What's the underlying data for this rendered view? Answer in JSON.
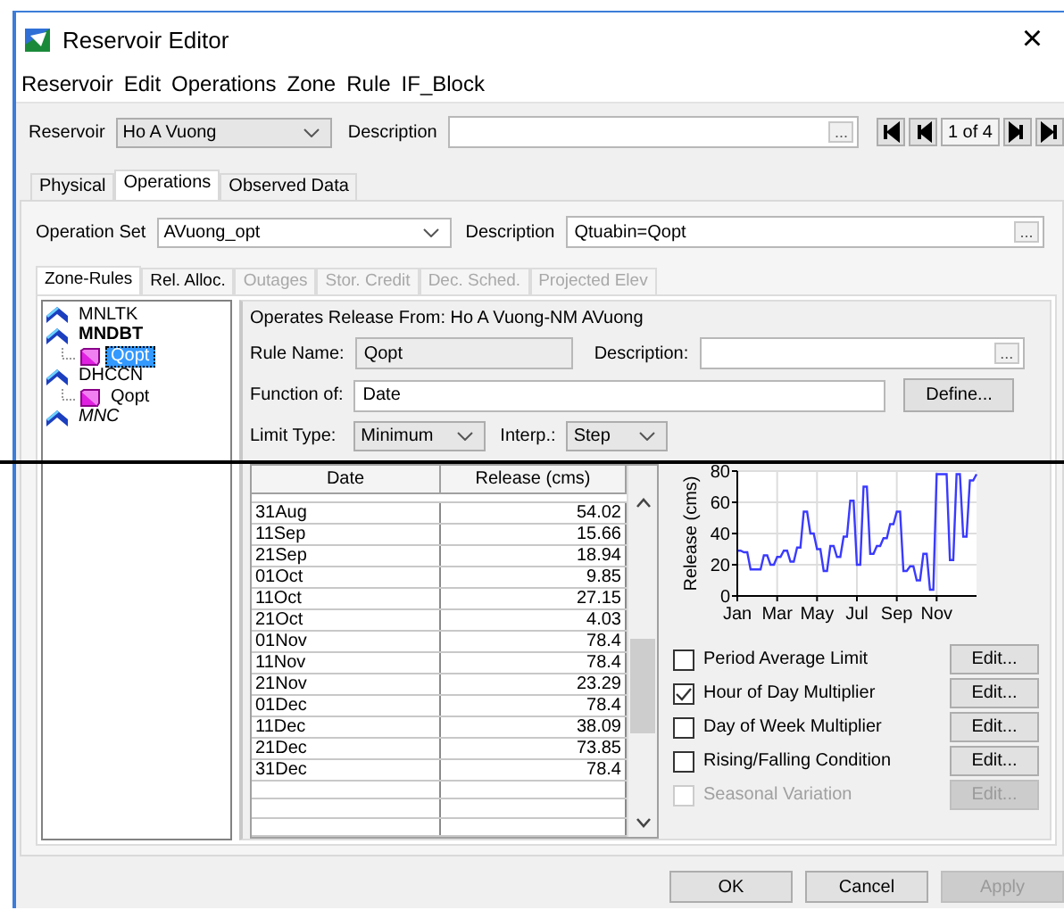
{
  "window": {
    "title": "Reservoir Editor",
    "close": "×"
  },
  "menu": [
    "Reservoir",
    "Edit",
    "Operations",
    "Zone",
    "Rule",
    "IF_Block"
  ],
  "reservoir": {
    "label": "Reservoir",
    "value": "Ho A Vuong",
    "description_label": "Description",
    "browse": "...",
    "record": "1 of 4"
  },
  "tabs": [
    {
      "label": "Physical",
      "selected": false
    },
    {
      "label": "Operations",
      "selected": true
    },
    {
      "label": "Observed Data",
      "selected": false
    }
  ],
  "operation_set": {
    "label": "Operation Set",
    "value": "AVuong_opt",
    "description_label": "Description",
    "description": "Qtuabin=Qopt",
    "browse": "..."
  },
  "sub_tabs": [
    {
      "label": "Zone-Rules",
      "selected": true,
      "disabled": false
    },
    {
      "label": "Rel. Alloc.",
      "selected": false,
      "disabled": false
    },
    {
      "label": "Outages",
      "selected": false,
      "disabled": true
    },
    {
      "label": "Stor. Credit",
      "selected": false,
      "disabled": true
    },
    {
      "label": "Dec. Sched.",
      "selected": false,
      "disabled": true
    },
    {
      "label": "Projected Elev",
      "selected": false,
      "disabled": true
    }
  ],
  "tree": [
    {
      "label": "MNLTK",
      "bold": false,
      "italic": false,
      "selected": false
    },
    {
      "label": "MNDBT",
      "bold": true,
      "italic": false,
      "selected": false,
      "children": [
        {
          "label": "Qopt",
          "bold": false,
          "italic": false,
          "selected": true
        }
      ]
    },
    {
      "label": "DHCCN",
      "bold": false,
      "italic": false,
      "selected": false,
      "children": [
        {
          "label": "Qopt",
          "bold": false,
          "italic": false,
          "selected": false
        }
      ]
    },
    {
      "label": "MNC",
      "bold": false,
      "italic": true,
      "selected": false
    }
  ],
  "rule": {
    "operates_from": "Operates Release From: Ho A Vuong-NM AVuong",
    "rule_name_label": "Rule Name:",
    "rule_name": "Qopt",
    "description_label": "Description:",
    "browse": "...",
    "function_label": "Function of:",
    "function": "Date",
    "define_button": "Define...",
    "limit_type_label": "Limit Type:",
    "limit_type": "Minimum",
    "interp_label": "Interp.:",
    "interp": "Step"
  },
  "table": {
    "columns": [
      "Date",
      "Release (cms)"
    ],
    "rows": [
      [
        "31Aug",
        "54.02"
      ],
      [
        "11Sep",
        "15.66"
      ],
      [
        "21Sep",
        "18.94"
      ],
      [
        "01Oct",
        "9.85"
      ],
      [
        "11Oct",
        "27.15"
      ],
      [
        "21Oct",
        "4.03"
      ],
      [
        "01Nov",
        "78.4"
      ],
      [
        "11Nov",
        "78.4"
      ],
      [
        "21Nov",
        "23.29"
      ],
      [
        "01Dec",
        "78.4"
      ],
      [
        "11Dec",
        "38.09"
      ],
      [
        "21Dec",
        "73.85"
      ],
      [
        "31Dec",
        "78.4"
      ]
    ]
  },
  "chart": {
    "chart_data": {
      "type": "line",
      "ylabel": "Release (cms)",
      "grid": true,
      "ylim": [
        0,
        80
      ],
      "yticks": [
        0,
        20,
        40,
        60,
        80
      ],
      "categories": [
        "Jan",
        null,
        null,
        null,
        null,
        null,
        null,
        null,
        null,
        null,
        null,
        null,
        "Mar",
        null,
        null,
        null,
        null,
        null,
        null,
        null,
        null,
        null,
        null,
        null,
        "May",
        null,
        null,
        null,
        null,
        null,
        null,
        null,
        null,
        null,
        null,
        null,
        "Jul",
        null,
        null,
        null,
        null,
        null,
        null,
        null,
        null,
        null,
        null,
        null,
        "Sep",
        null,
        null,
        null,
        null,
        null,
        null,
        null,
        null,
        null,
        null,
        null,
        "Nov",
        null,
        null,
        null,
        null,
        null,
        null,
        null,
        null,
        null,
        null,
        null,
        null
      ],
      "series": [
        {
          "color": "#3a3aff",
          "values": [
            29,
            29,
            28,
            28,
            17,
            17,
            17,
            17,
            26,
            26,
            20,
            20,
            25,
            25,
            29,
            29,
            22,
            22,
            31,
            31,
            54,
            54,
            40,
            40,
            30,
            30,
            16,
            16,
            32,
            32,
            25,
            25,
            38,
            38,
            61,
            61,
            20,
            20,
            70,
            70,
            27,
            27,
            32,
            32,
            37,
            37,
            46,
            46,
            54,
            54,
            16,
            16,
            19,
            19,
            10,
            10,
            27,
            27,
            4,
            4,
            78,
            78,
            78,
            78,
            23,
            23,
            78,
            78,
            38,
            38,
            74,
            74,
            78
          ]
        }
      ]
    }
  },
  "options": [
    {
      "label": "Period Average Limit",
      "checked": false,
      "disabled": false,
      "button": "Edit..."
    },
    {
      "label": "Hour of Day Multiplier",
      "checked": true,
      "disabled": false,
      "button": "Edit..."
    },
    {
      "label": "Day of Week Multiplier",
      "checked": false,
      "disabled": false,
      "button": "Edit..."
    },
    {
      "label": "Rising/Falling Condition",
      "checked": false,
      "disabled": false,
      "button": "Edit..."
    },
    {
      "label": "Seasonal Variation",
      "checked": false,
      "disabled": true,
      "button": "Edit..."
    }
  ],
  "buttons": [
    {
      "label": "OK",
      "disabled": false
    },
    {
      "label": "Cancel",
      "disabled": false
    },
    {
      "label": "Apply",
      "disabled": true
    }
  ]
}
